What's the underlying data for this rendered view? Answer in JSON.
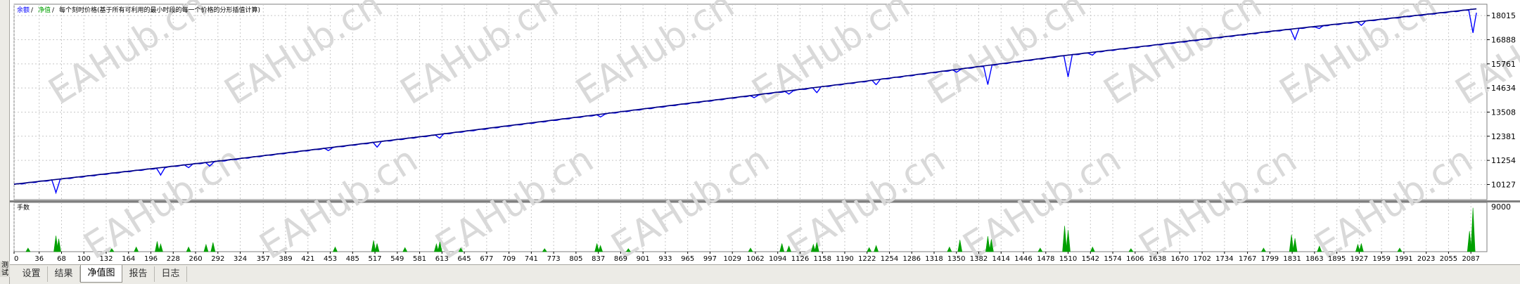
{
  "sidebar": {
    "vertical_label": "测试器",
    "vertical_short": "测试"
  },
  "tabs": [
    {
      "label": "设置",
      "active": false
    },
    {
      "label": "结果",
      "active": false
    },
    {
      "label": "净值图",
      "active": true
    },
    {
      "label": "报告",
      "active": false
    },
    {
      "label": "日志",
      "active": false
    }
  ],
  "watermark": "EAHub.cn",
  "colors": {
    "balance": "#000080",
    "equity": "#0000ff",
    "lots": "#00a000",
    "grid": "#c8c8c8",
    "legend_balance": "#0000ff",
    "legend_equity": "#00a000"
  },
  "chart_data": [
    {
      "type": "line",
      "legend": [
        {
          "label": "余额",
          "color": "#0000ff"
        },
        {
          "label": "净值",
          "color": "#00a000"
        }
      ],
      "legend_note": "每个刻时价格(基于所有可利用的最小时段的每一个价格的分形插值计算)",
      "y_ticks": [
        10127,
        11254,
        12381,
        13508,
        14634,
        15761,
        16888,
        18015
      ],
      "ylim": [
        9420,
        18480
      ],
      "xlim": [
        0,
        2110
      ],
      "series": [
        {
          "name": "余额",
          "x": [
            0,
            300,
            600,
            900,
            1200,
            1500,
            1800,
            2095
          ],
          "values": [
            10140,
            11250,
            12430,
            13650,
            14870,
            16130,
            17280,
            18330
          ]
        }
      ],
      "equity_dips": [
        {
          "x": 60,
          "depth": 600
        },
        {
          "x": 210,
          "depth": 350
        },
        {
          "x": 250,
          "depth": 120
        },
        {
          "x": 280,
          "depth": 180
        },
        {
          "x": 450,
          "depth": 120
        },
        {
          "x": 520,
          "depth": 220
        },
        {
          "x": 610,
          "depth": 160
        },
        {
          "x": 840,
          "depth": 120
        },
        {
          "x": 1060,
          "depth": 120
        },
        {
          "x": 1110,
          "depth": 160
        },
        {
          "x": 1150,
          "depth": 220
        },
        {
          "x": 1235,
          "depth": 200
        },
        {
          "x": 1350,
          "depth": 120
        },
        {
          "x": 1395,
          "depth": 900
        },
        {
          "x": 1510,
          "depth": 1000
        },
        {
          "x": 1545,
          "depth": 120
        },
        {
          "x": 1835,
          "depth": 500
        },
        {
          "x": 1870,
          "depth": 120
        },
        {
          "x": 1930,
          "depth": 160
        },
        {
          "x": 2090,
          "depth": 1100
        }
      ]
    },
    {
      "type": "bar",
      "title": "手数",
      "y_ticks": [
        9000
      ],
      "ylim": [
        0,
        9000
      ],
      "x_ticks": [
        0,
        36,
        68,
        100,
        132,
        164,
        196,
        228,
        260,
        292,
        324,
        357,
        389,
        421,
        453,
        485,
        517,
        549,
        581,
        613,
        645,
        677,
        709,
        741,
        773,
        805,
        837,
        869,
        901,
        933,
        965,
        997,
        1029,
        1062,
        1094,
        1126,
        1158,
        1190,
        1222,
        1254,
        1286,
        1318,
        1350,
        1382,
        1414,
        1446,
        1478,
        1510,
        1542,
        1574,
        1606,
        1638,
        1670,
        1702,
        1734,
        1767,
        1799,
        1831,
        1863,
        1895,
        1927,
        1959,
        1991,
        2023,
        2055,
        2087
      ],
      "xlim": [
        0,
        2110
      ],
      "x": [
        20,
        60,
        64,
        140,
        175,
        205,
        210,
        250,
        275,
        285,
        460,
        515,
        520,
        560,
        605,
        610,
        640,
        760,
        835,
        840,
        880,
        1055,
        1100,
        1110,
        1145,
        1150,
        1225,
        1235,
        1340,
        1355,
        1395,
        1400,
        1470,
        1505,
        1510,
        1545,
        1600,
        1790,
        1830,
        1835,
        1870,
        1925,
        1930,
        1985,
        2085,
        2090
      ],
      "values": [
        700,
        3100,
        2500,
        600,
        900,
        2000,
        1500,
        900,
        1400,
        1800,
        900,
        2200,
        1600,
        800,
        1500,
        1900,
        700,
        600,
        1600,
        1200,
        600,
        700,
        1600,
        1100,
        1400,
        1800,
        800,
        1200,
        900,
        2300,
        3000,
        2400,
        700,
        5000,
        4200,
        900,
        600,
        700,
        3300,
        2600,
        1100,
        1400,
        1600,
        700,
        4000,
        8500
      ]
    }
  ]
}
